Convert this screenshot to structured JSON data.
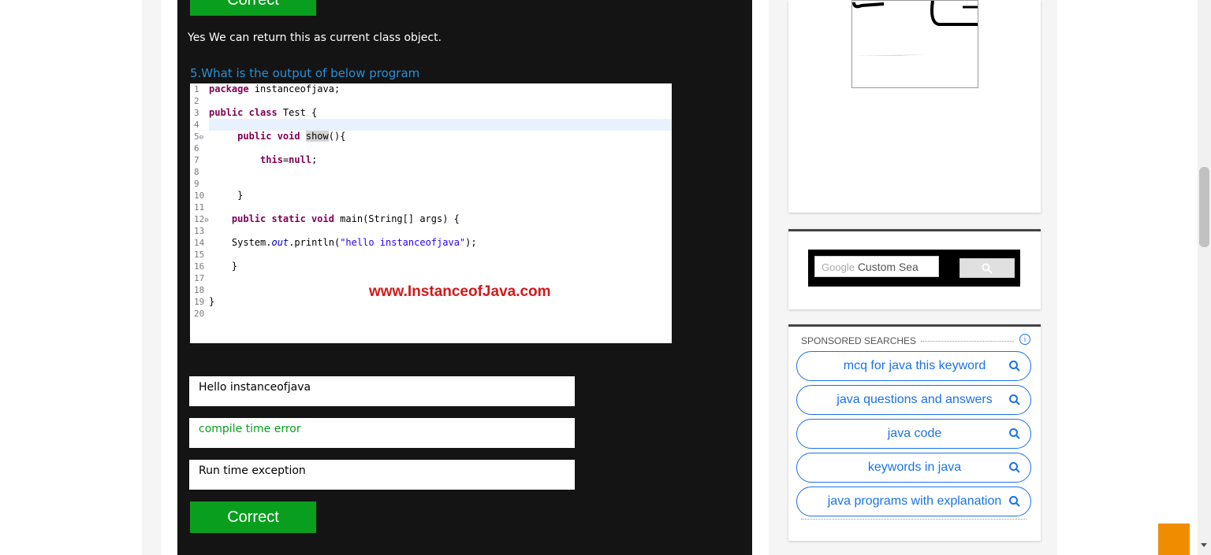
{
  "quiz": {
    "prev_correct_label": "Correct",
    "prev_answer_text": "Yes We can return this as current class object.",
    "question_text": "5.What is the output of below program",
    "code_lines": [
      {
        "n": "1",
        "t": "package instanceofjava;"
      },
      {
        "n": "2",
        "t": ""
      },
      {
        "n": "3",
        "t": "public class Test {"
      },
      {
        "n": "4",
        "t": ""
      },
      {
        "n": "5",
        "t": "public void show(){"
      },
      {
        "n": "6",
        "t": ""
      },
      {
        "n": "7",
        "t": "this=null;"
      },
      {
        "n": "8",
        "t": ""
      },
      {
        "n": "9",
        "t": ""
      },
      {
        "n": "10",
        "t": "}"
      },
      {
        "n": "11",
        "t": ""
      },
      {
        "n": "12",
        "t": "public static void main(String[] args) {"
      },
      {
        "n": "13",
        "t": ""
      },
      {
        "n": "14",
        "t": "System.out.println(\"hello instanceofjava\");"
      },
      {
        "n": "15",
        "t": ""
      },
      {
        "n": "16",
        "t": "}"
      },
      {
        "n": "17",
        "t": ""
      },
      {
        "n": "18",
        "t": ""
      },
      {
        "n": "19",
        "t": "}"
      },
      {
        "n": "20",
        "t": ""
      }
    ],
    "watermark": "www.InstanceofJava.com",
    "options": [
      {
        "label": "Hello instanceofjava"
      },
      {
        "label": "compile time error"
      },
      {
        "label": "Run time exception"
      }
    ],
    "correct_label": "Correct"
  },
  "sidebar": {
    "search_placeholder_brand": "Google",
    "search_placeholder": "Custom Sea",
    "sponsored_heading": "SPONSORED SEARCHES",
    "info_symbol": "i",
    "sponsored_items": [
      {
        "label": "mcq for java this keyword"
      },
      {
        "label": "java questions and answers"
      },
      {
        "label": "java code"
      },
      {
        "label": "keywords in java"
      },
      {
        "label": "java programs with explanation"
      }
    ]
  },
  "colors": {
    "accent_green": "#0a9e1e",
    "link_blue": "#1a73e8",
    "question_blue": "#2a8fd8",
    "back_to_top": "#f08c00"
  }
}
